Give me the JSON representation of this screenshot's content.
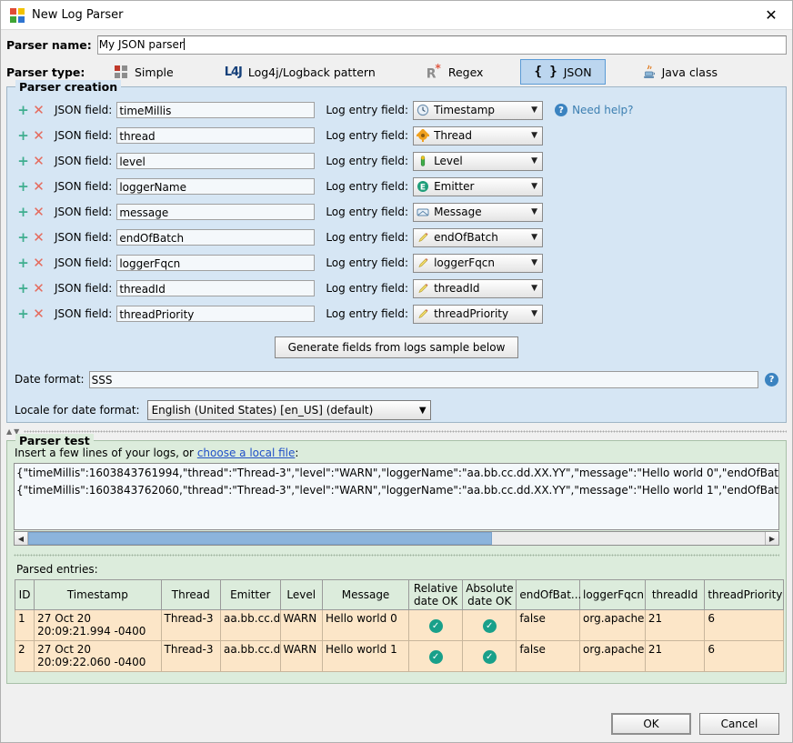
{
  "window": {
    "title": "New Log Parser",
    "icon": "app-squares-icon",
    "close_label": "✕"
  },
  "parser_name": {
    "label": "Parser name:",
    "value": "My JSON parser",
    "placeholder": ""
  },
  "parser_type": {
    "label": "Parser type:",
    "tabs": [
      {
        "label": "Simple",
        "icon": "squares-icon",
        "selected": false
      },
      {
        "label": "Log4j/Logback pattern",
        "icon": "log4j-icon",
        "selected": false
      },
      {
        "label": "Regex",
        "icon": "regex-icon",
        "selected": false
      },
      {
        "label": "JSON",
        "icon": "braces-icon",
        "selected": true
      },
      {
        "label": "Java class",
        "icon": "java-cup-icon",
        "selected": false
      }
    ]
  },
  "creation": {
    "title": "Parser creation",
    "add_label": "+",
    "remove_label": "✕",
    "json_field_label": "JSON field:",
    "log_entry_field_label": "Log entry field:",
    "rows": [
      {
        "json_field": "timeMillis",
        "log_field": "Timestamp",
        "icon": "clock-icon"
      },
      {
        "json_field": "thread",
        "log_field": "Thread",
        "icon": "gear-icon"
      },
      {
        "json_field": "level",
        "log_field": "Level",
        "icon": "thermometer-icon"
      },
      {
        "json_field": "loggerName",
        "log_field": "Emitter",
        "icon": "emitter-e-icon"
      },
      {
        "json_field": "message",
        "log_field": "Message",
        "icon": "envelope-icon"
      },
      {
        "json_field": "endOfBatch",
        "log_field": "endOfBatch",
        "icon": "pencil-icon"
      },
      {
        "json_field": "loggerFqcn",
        "log_field": "loggerFqcn",
        "icon": "pencil-icon"
      },
      {
        "json_field": "threadId",
        "log_field": "threadId",
        "icon": "pencil-icon"
      },
      {
        "json_field": "threadPriority",
        "log_field": "threadPriority",
        "icon": "pencil-icon"
      }
    ],
    "need_help": "Need help?",
    "need_help_icon": "question-mark-icon",
    "generate_button": "Generate fields from logs sample below",
    "date_format_label": "Date format:",
    "date_format_value": "SSS",
    "date_format_help_icon": "question-mark-icon",
    "locale_label": "Locale for date format:",
    "locale_value": "English (United States) [en_US]   (default)"
  },
  "splitter": {
    "up_icon": "collapse-up-icon",
    "down_icon": "collapse-down-icon"
  },
  "test": {
    "title": "Parser test",
    "hint_prefix": "Insert a few lines of your logs, or ",
    "hint_link": "choose a local file",
    "hint_suffix": ":",
    "log_lines": [
      "{\"timeMillis\":1603843761994,\"thread\":\"Thread-3\",\"level\":\"WARN\",\"loggerName\":\"aa.bb.cc.dd.XX.YY\",\"message\":\"Hello world 0\",\"endOfBatch\":fa",
      "{\"timeMillis\":1603843762060,\"thread\":\"Thread-3\",\"level\":\"WARN\",\"loggerName\":\"aa.bb.cc.dd.XX.YY\",\"message\":\"Hello world 1\",\"endOfBatch\":fa"
    ],
    "scroll_left_icon": "arrow-left-icon",
    "scroll_right_icon": "arrow-right-icon",
    "parsed_entries_label": "Parsed entries:",
    "table": {
      "columns": [
        "ID",
        "Timestamp",
        "Thread",
        "Emitter",
        "Level",
        "Message",
        "Relative date OK",
        "Absolute date OK",
        "endOfBat...",
        "loggerFqcn",
        "threadId",
        "threadPriority"
      ],
      "rows": [
        {
          "id": "1",
          "timestamp": "27 Oct 20 20:09:21.994 -0400",
          "thread": "Thread-3",
          "emitter": "aa.bb.cc.dd.XX.YY",
          "level": "WARN",
          "message": "Hello world 0",
          "relative_date_ok": "✓",
          "absolute_date_ok": "✓",
          "end_of_batch": "false",
          "logger_fqcn": "org.apache.logging.lo",
          "thread_id": "21",
          "thread_priority": "6"
        },
        {
          "id": "2",
          "timestamp": "27 Oct 20 20:09:22.060 -0400",
          "thread": "Thread-3",
          "emitter": "aa.bb.cc.dd.XX.YY",
          "level": "WARN",
          "message": "Hello world 1",
          "relative_date_ok": "✓",
          "absolute_date_ok": "✓",
          "end_of_batch": "false",
          "logger_fqcn": "org.apache.logging.lo",
          "thread_id": "21",
          "thread_priority": "6"
        }
      ]
    }
  },
  "footer": {
    "ok": "OK",
    "cancel": "Cancel"
  },
  "colors": {
    "creation_bg": "#d6e6f4",
    "test_bg": "#dcecdc",
    "selected_tab_bg": "#bcd6ef",
    "selected_tab_border": "#5b9bd5",
    "table_row_bg": "#fce6c8",
    "table_header_bg": "#dcecdc",
    "link": "#2050c8",
    "help_link": "#3c7fb1",
    "ok_check": "#19a08a",
    "scroll_thumb": "#8cb4dc"
  }
}
